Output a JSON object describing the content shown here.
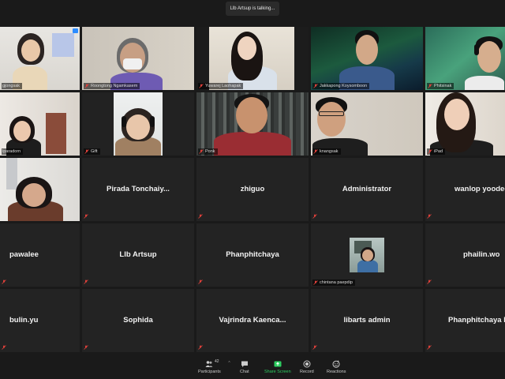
{
  "banner": {
    "talking": "Llb Artsup is talking..."
  },
  "video_tiles": [
    {
      "name": "gjongsak",
      "muted": false
    },
    {
      "name": "Roongtong Ngamkasem",
      "muted": true
    },
    {
      "name": "Yuwarej Laohapak",
      "muted": true
    },
    {
      "name": "Jakkapong Koysomboon",
      "muted": true
    },
    {
      "name": "Phitsinak",
      "muted": true
    },
    {
      "name": "lparadorn",
      "muted": false
    },
    {
      "name": "Gift",
      "muted": true
    },
    {
      "name": "Ponk",
      "muted": true
    },
    {
      "name": "knangsak",
      "muted": true
    },
    {
      "name": "iPad",
      "muted": true
    },
    {
      "name": "",
      "muted": false
    }
  ],
  "name_tiles": {
    "pirada": "Pirada  Tonchaiy...",
    "zhiguo": "zhiguo",
    "administrator": "Administrator",
    "wanlop": "wanlop yoodee",
    "pawalee": "pawalee",
    "llb_artsup": "Llb Artsup",
    "phanphitchaya": "Phanphitchaya",
    "chintana": "chintana paepdip",
    "phailin": "phailin.wo",
    "bulin": "bulin.yu",
    "sophida": "Sophida",
    "vajrindra": "Vajrindra  Kaenca...",
    "libarts": "libarts admin",
    "phanphitchaya2": "Phanphitchaya  P"
  },
  "toolbar": {
    "participants_count": "42",
    "participants": "Participants",
    "chat": "Chat",
    "share": "Share Screen",
    "record": "Record",
    "reactions": "Reactions"
  },
  "colors": {
    "speaking_border": "#f5c518",
    "share_green": "#2dce61",
    "mute_red": "#e0403a"
  }
}
